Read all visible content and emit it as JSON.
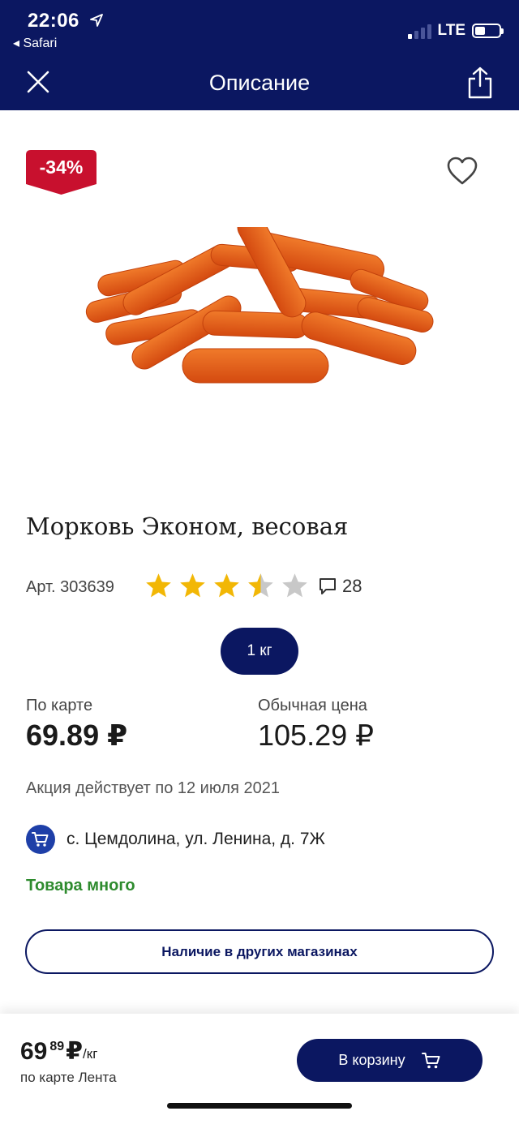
{
  "status_bar": {
    "time": "22:06",
    "back_app": "◂ Safari",
    "network": "LTE"
  },
  "header": {
    "title": "Описание",
    "close_icon": "close-icon",
    "share_icon": "share-icon"
  },
  "product": {
    "discount": "-34%",
    "name": "Морковь Эконом, весовая",
    "article": "Арт. 303639",
    "rating": 3.5,
    "rating_max": 5,
    "reviews_count": "28",
    "weight_option": "1 кг",
    "card_price_label": "По карте",
    "card_price": "69.89 ₽",
    "regular_price_label": "Обычная цена",
    "regular_price": "105.29 ₽",
    "promo_text": "Акция действует по 12 июля 2021",
    "store_address": "с.  Цемдолина, ул. Ленина, д. 7Ж",
    "stock_status": "Товара много",
    "other_stores_button": "Наличие в других магазинах"
  },
  "bottom_bar": {
    "price_int": "69",
    "price_frac": "89",
    "currency": "₽",
    "unit": "/кг",
    "subtitle": "по карте Лента",
    "cart_button": "В корзину"
  },
  "colors": {
    "brand_navy": "#0b1761",
    "discount_red": "#c8102e",
    "star_gold": "#f2b705",
    "stock_green": "#2e8b2e"
  }
}
